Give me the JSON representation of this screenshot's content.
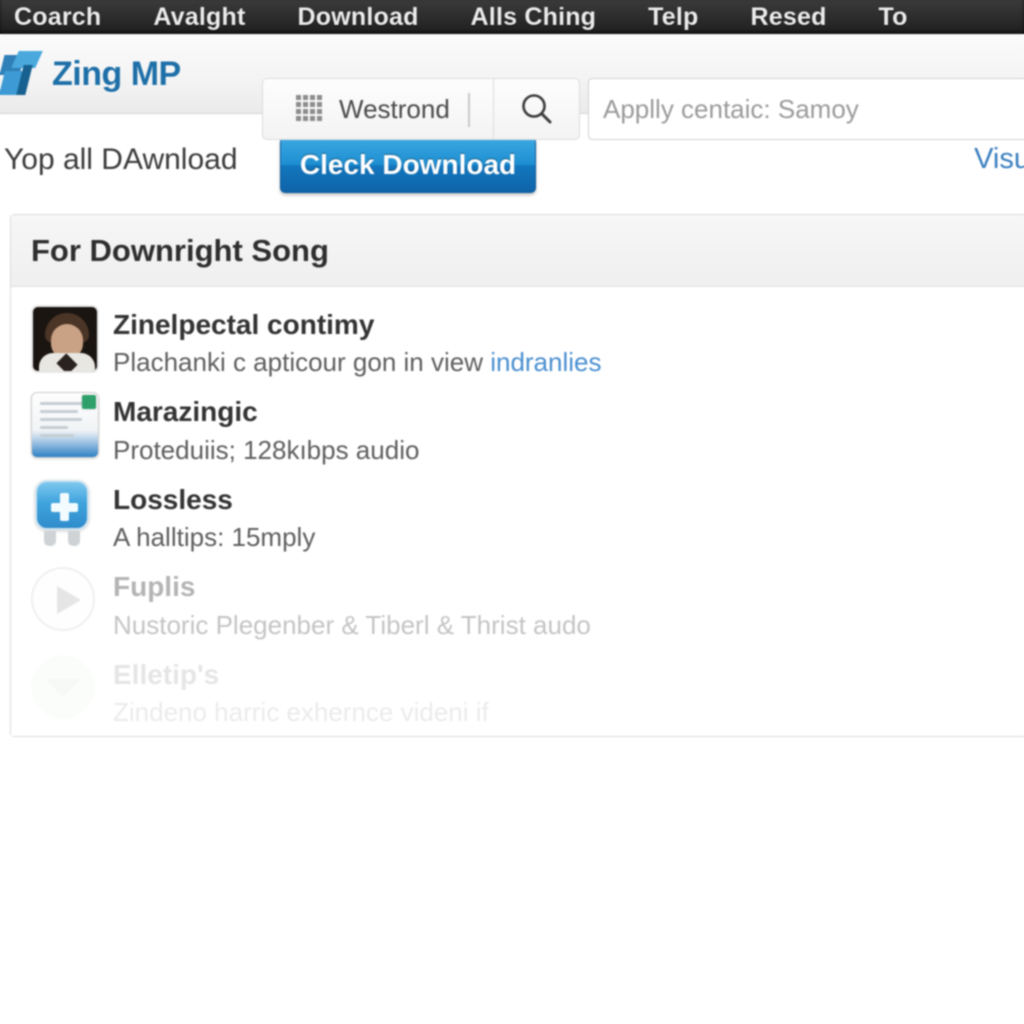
{
  "topnav": {
    "items": [
      {
        "label": "Coarch",
        "name": "topnav-item-coarch"
      },
      {
        "label": "Avalght",
        "name": "topnav-item-avalght"
      },
      {
        "label": "Download",
        "name": "topnav-item-download"
      },
      {
        "label": "Alls Ching",
        "name": "topnav-item-alls-ching"
      },
      {
        "label": "Telp",
        "name": "topnav-item-telp"
      },
      {
        "label": "Resed",
        "name": "topnav-item-resed"
      },
      {
        "label": "To",
        "name": "topnav-item-to"
      }
    ]
  },
  "header": {
    "logo_text": "Zing MP",
    "logo_icon": "zing-logo-icon",
    "switcher_label": "Westrond",
    "switcher_icon": "grid-icon",
    "search_icon": "search-icon",
    "search": {
      "value": "",
      "placeholder": "Applly centaic: Samoy"
    }
  },
  "action_row": {
    "label": "Yop all DAwnload",
    "download_button": "Cleck Download",
    "visual_link": "Visu"
  },
  "card": {
    "title": "For Downright Song",
    "options": [
      {
        "title": "Zinelpectal contimy",
        "subtitle": "Plachanki c apticour gon in view ",
        "subtitle_link": "indranlies",
        "icon": "user-photo-avatar",
        "state": "normal"
      },
      {
        "title": "Marazingic",
        "subtitle": "Proteduiis; 128kıbps audio",
        "subtitle_link": "",
        "icon": "document-window-icon",
        "state": "normal"
      },
      {
        "title": "Lossless",
        "subtitle": "A halltips: 15mply",
        "subtitle_link": "",
        "icon": "lossless-plus-icon",
        "state": "normal"
      },
      {
        "title": "Fuplis",
        "subtitle": "Nustoric Plegenber & Tiberl & Thrist audo",
        "subtitle_link": "",
        "icon": "play-circle-icon",
        "state": "dimmed"
      },
      {
        "title": "Elletip's",
        "subtitle": "Zindeno harric exhernce videni if",
        "subtitle_link": "",
        "icon": "eye-circle-icon",
        "state": "faded"
      }
    ]
  },
  "colors": {
    "topnav_bg": "#2b2b2b",
    "accent_blue": "#1e8fd2",
    "logo_blue": "#1e6fa8",
    "link_blue": "#3a7fbf",
    "card_bg": "#ffffff",
    "card_header_bg": "#f2f2f2"
  }
}
